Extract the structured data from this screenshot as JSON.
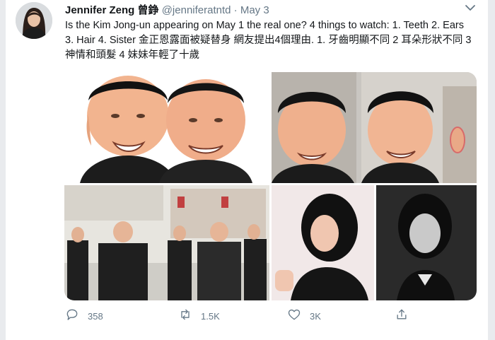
{
  "tweet": {
    "author_name": "Jennifer Zeng 曾錚",
    "handle": "@jenniferatntd",
    "separator": "·",
    "date": "May 3",
    "text": "Is the Kim Jong-un appearing on May 1 the real one? 4 things to watch: 1. Teeth 2. Ears 3. Hair 4. Sister 金正恩露面被疑替身 網友提出4個理由. 1. 牙齒明顯不同 2 耳朵形狀不同 3 神情和頭髮 4 妹妹年輕了十歲"
  },
  "actions": {
    "replies": "358",
    "retweets": "1.5K",
    "likes": "3K"
  },
  "icons": {
    "menu": "chevron-down-icon",
    "reply": "reply-icon",
    "retweet": "retweet-icon",
    "like": "heart-icon",
    "share": "share-icon"
  },
  "colors": {
    "text": "#14171a",
    "muted": "#657786",
    "background": "#e9ebee"
  }
}
